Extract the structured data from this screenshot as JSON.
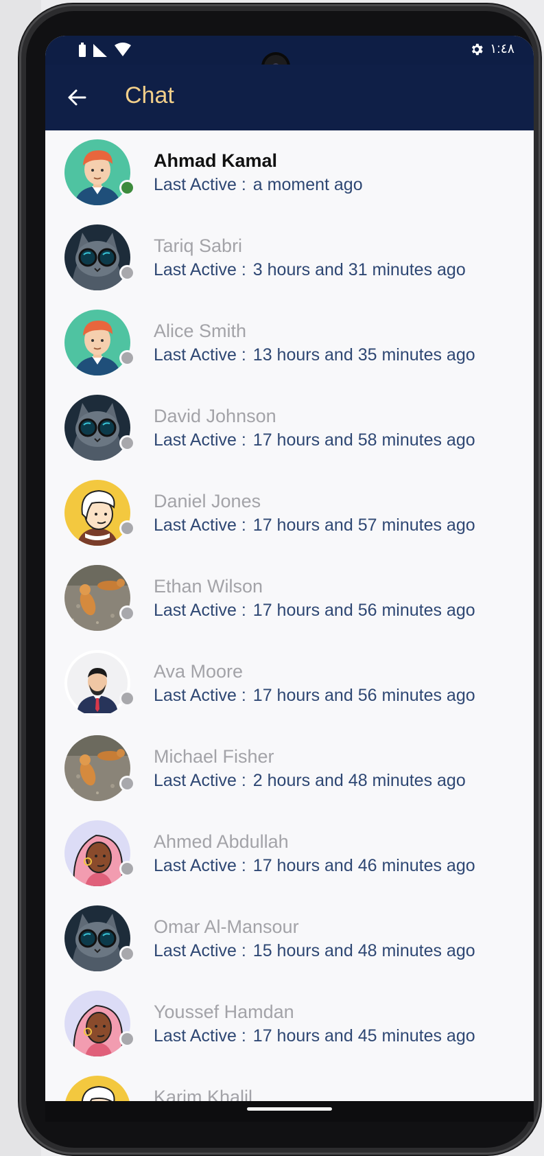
{
  "status_bar": {
    "time": "١:٤٨"
  },
  "app_bar": {
    "title": "Chat"
  },
  "last_active_label": "Last Active :",
  "contacts": [
    {
      "name": "Ahmad Kamal",
      "last_active": "a moment ago",
      "online": true,
      "avatar": "cartoon-man-redhair"
    },
    {
      "name": "Tariq Sabri",
      "last_active": "3 hours and 31 minutes ago",
      "online": false,
      "avatar": "cat-sunglasses"
    },
    {
      "name": "Alice Smith",
      "last_active": "13 hours and 35 minutes ago",
      "online": false,
      "avatar": "cartoon-man-redhair"
    },
    {
      "name": "David Johnson",
      "last_active": "17 hours and 58 minutes ago",
      "online": false,
      "avatar": "cat-sunglasses"
    },
    {
      "name": "Daniel Jones",
      "last_active": "17 hours and 57 minutes ago",
      "online": false,
      "avatar": "cartoon-woman-white-hair"
    },
    {
      "name": "Ethan Wilson",
      "last_active": "17 hours and 56 minutes ago",
      "online": false,
      "avatar": "cats-photo"
    },
    {
      "name": "Ava Moore",
      "last_active": "17 hours and 56 minutes ago",
      "online": false,
      "avatar": "man-in-suit"
    },
    {
      "name": "Michael Fisher",
      "last_active": "2 hours and 48 minutes ago",
      "online": false,
      "avatar": "cats-photo"
    },
    {
      "name": "Ahmed Abdullah",
      "last_active": "17 hours and 46 minutes ago",
      "online": false,
      "avatar": "cartoon-woman-pink-hair"
    },
    {
      "name": "Omar Al-Mansour",
      "last_active": "15 hours and 48 minutes ago",
      "online": false,
      "avatar": "cat-sunglasses"
    },
    {
      "name": "Youssef Hamdan",
      "last_active": "17 hours and 45 minutes ago",
      "online": false,
      "avatar": "cartoon-woman-pink-hair"
    },
    {
      "name": "Karim Khalil",
      "last_active": "",
      "online": false,
      "avatar": "cartoon-woman-white-hair"
    }
  ]
}
